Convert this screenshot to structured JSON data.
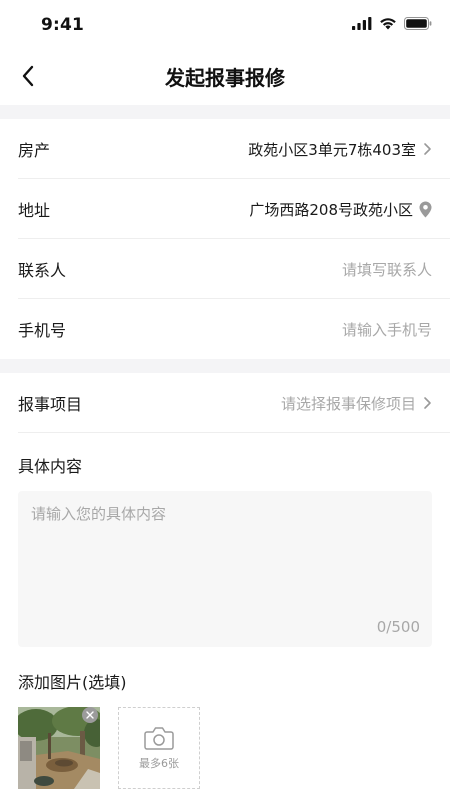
{
  "status_bar": {
    "time": "9:41"
  },
  "nav": {
    "title": "发起报事报修"
  },
  "form": {
    "property": {
      "label": "房产",
      "value": "政苑小区3单元7栋403室"
    },
    "address": {
      "label": "地址",
      "value": "广场西路208号政苑小区"
    },
    "contact": {
      "label": "联系人",
      "placeholder": "请填写联系人"
    },
    "phone": {
      "label": "手机号",
      "placeholder": "请输入手机号"
    },
    "item": {
      "label": "报事项目",
      "placeholder": "请选择报事保修项目"
    }
  },
  "content": {
    "title": "具体内容",
    "placeholder": "请输入您的具体内容",
    "counter": "0/500"
  },
  "photos": {
    "title": "添加图片(选填)",
    "add_label": "最多6张"
  },
  "icons": {
    "back": "chevron-left-icon",
    "chevron": "chevron-right-icon",
    "location": "location-pin-icon",
    "camera": "camera-icon",
    "remove": "close-icon"
  },
  "colors": {
    "section_gap": "#f4f4f6",
    "placeholder": "#a8a8a8",
    "text": "#1a1a1a"
  }
}
